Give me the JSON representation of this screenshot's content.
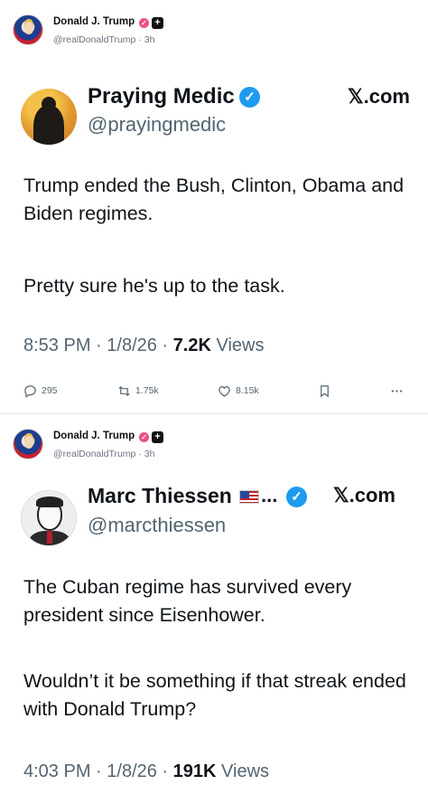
{
  "posts": [
    {
      "author": {
        "name": "Donald J. Trump",
        "handle": "@realDonaldTrump",
        "time": "3h",
        "separator": "·"
      },
      "embed": {
        "name": "Praying Medic",
        "handle": "@prayingmedic",
        "brand": "𝕏.com",
        "text_line1": "Trump ended the Bush, Clinton, Obama and Biden regimes.",
        "text_line2": "Pretty sure he's up to the task.",
        "time": "8:53 PM",
        "date": "1/8/26",
        "views_count": "7.2K",
        "views_label": "Views"
      },
      "actions": {
        "replies": "295",
        "reposts": "1.75k",
        "likes": "8.15k"
      }
    },
    {
      "author": {
        "name": "Donald J. Trump",
        "handle": "@realDonaldTrump",
        "time": "3h",
        "separator": "·"
      },
      "embed": {
        "name": "Marc Thiessen",
        "name_suffix": "...",
        "handle": "@marcthiessen",
        "brand": "𝕏.com",
        "text_line1": "The Cuban regime has survived every president since Eisenhower.",
        "text_line2": "Wouldn’t it be something if that streak ended with Donald Trump?",
        "time": "4:03 PM",
        "date": "1/8/26",
        "views_count": "191K",
        "views_label": "Views"
      }
    }
  ],
  "colors": {
    "accent_blue": "#1d9bf0",
    "verified_pink": "#ef4e8a",
    "muted_text": "#536471"
  },
  "icons": [
    "verified-pink-icon",
    "plus-badge-icon",
    "blue-check-icon",
    "us-flag-icon",
    "reply-icon",
    "repost-icon",
    "like-icon",
    "bookmark-icon",
    "more-icon"
  ]
}
